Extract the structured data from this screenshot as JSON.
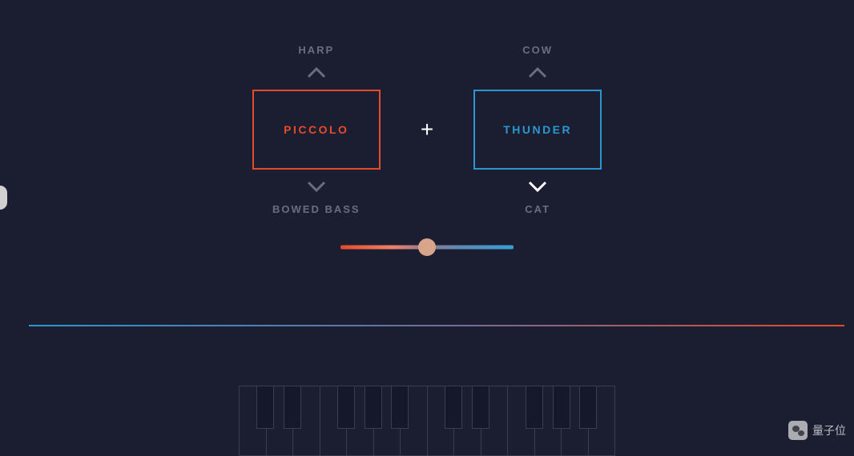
{
  "selectors": {
    "left": {
      "prev_option": "HARP",
      "current": "PICCOLO",
      "next_option": "BOWED BASS",
      "color": "#e54b2a"
    },
    "right": {
      "prev_option": "COW",
      "current": "THUNDER",
      "next_option": "CAT",
      "color": "#2a97d3"
    },
    "combine_symbol": "+"
  },
  "slider": {
    "value": 50,
    "min": 0,
    "max": 100
  },
  "keyboard": {
    "white_key_count": 14,
    "black_key_positions_pct": [
      4.7,
      11.9,
      26.2,
      33.3,
      40.5,
      54.7,
      61.9,
      76.2,
      83.3,
      90.5
    ]
  },
  "watermark": {
    "text": "量子位"
  }
}
